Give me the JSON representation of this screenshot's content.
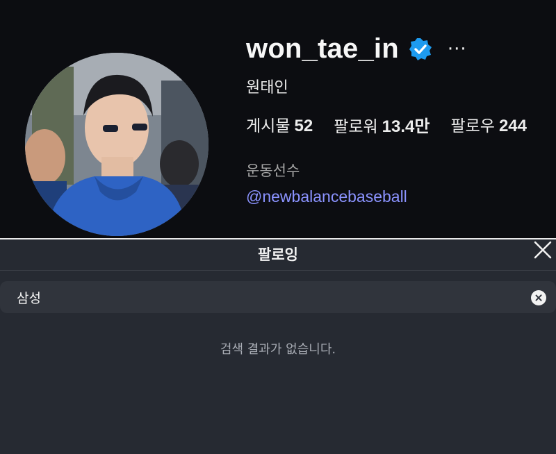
{
  "profile": {
    "username": "won_tae_in",
    "more_label": "···",
    "full_name": "원태인",
    "stats": [
      {
        "label": "게시물",
        "value": "52"
      },
      {
        "label": "팔로워",
        "value": "13.4만"
      },
      {
        "label": "팔로우",
        "value": "244"
      }
    ],
    "category": "운동선수",
    "link": "@newbalancebaseball",
    "verified_color": "#1d9bf0",
    "link_color": "#8b93ff"
  },
  "dialog": {
    "title": "팔로잉",
    "search_value": "삼성",
    "no_results": "검색 결과가 없습니다."
  }
}
